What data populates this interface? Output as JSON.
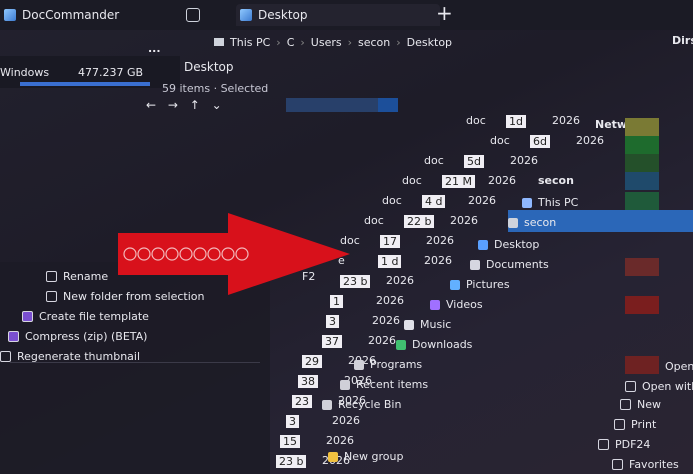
{
  "window": {
    "app_title": "DocCommander",
    "tab_label": "Desktop",
    "new_tab_symbol": "+"
  },
  "pathbar": {
    "segments": [
      "This PC",
      "C",
      "Users",
      "secon",
      "Desktop"
    ],
    "right_label": "Dirs"
  },
  "left_panel": {
    "drive_label": "Windows",
    "drive_size": "477.237 GB",
    "more_symbol": "..."
  },
  "tab_panel": {
    "title": "Desktop",
    "status": "59 items · Selected"
  },
  "file_rows": [
    {
      "type": "doc",
      "size": "1d",
      "year": "2026"
    },
    {
      "type": "doc",
      "size": "6d",
      "year": "2026"
    },
    {
      "type": "doc",
      "size": "5d",
      "year": "2026"
    },
    {
      "type": "doc",
      "size": "21 M",
      "year": "2026"
    },
    {
      "type": "doc",
      "size": "4 d",
      "year": "2026"
    },
    {
      "type": "doc",
      "size": "22 b",
      "year": "2026"
    },
    {
      "type": "doc",
      "size": "17",
      "year": "2026"
    },
    {
      "type": "e",
      "size": "1 d",
      "year": "2026"
    },
    {
      "type": "",
      "size": "23 b",
      "year": "2026"
    },
    {
      "type": "",
      "size": "1",
      "year": "2026"
    },
    {
      "type": "",
      "size": "3",
      "year": "2026"
    },
    {
      "type": "",
      "size": "37",
      "year": "2026"
    },
    {
      "type": "",
      "size": "29",
      "year": "2026"
    },
    {
      "type": "",
      "size": "38",
      "year": "2026"
    },
    {
      "type": "",
      "size": "23",
      "year": "2026"
    },
    {
      "type": "",
      "size": "3",
      "year": "2026"
    },
    {
      "type": "",
      "size": "15",
      "year": "2026"
    },
    {
      "type": "",
      "size": "23 b",
      "year": "2026"
    }
  ],
  "nav_list": {
    "header": "Network",
    "user_label": "secon",
    "items": [
      "This PC",
      "secon",
      "Desktop",
      "Documents",
      "Pictures",
      "Videos",
      "Music",
      "Downloads",
      "Programs",
      "Recent items",
      "Recycle Bin",
      "New group"
    ]
  },
  "context_menu": {
    "items": [
      "Rename",
      "New folder from selection",
      "Create file template",
      "Compress (zip) (BETA)",
      "Regenerate thumbnail"
    ],
    "rename_shortcut": "F2"
  },
  "right_menu": {
    "items": [
      "Open",
      "Open with",
      "New",
      "Print",
      "PDF24",
      "Favorites"
    ]
  },
  "colors": {
    "arrow_red": "#d8111b",
    "selection_blue": "#2b67b8",
    "titlebar": "#1b1b25"
  }
}
